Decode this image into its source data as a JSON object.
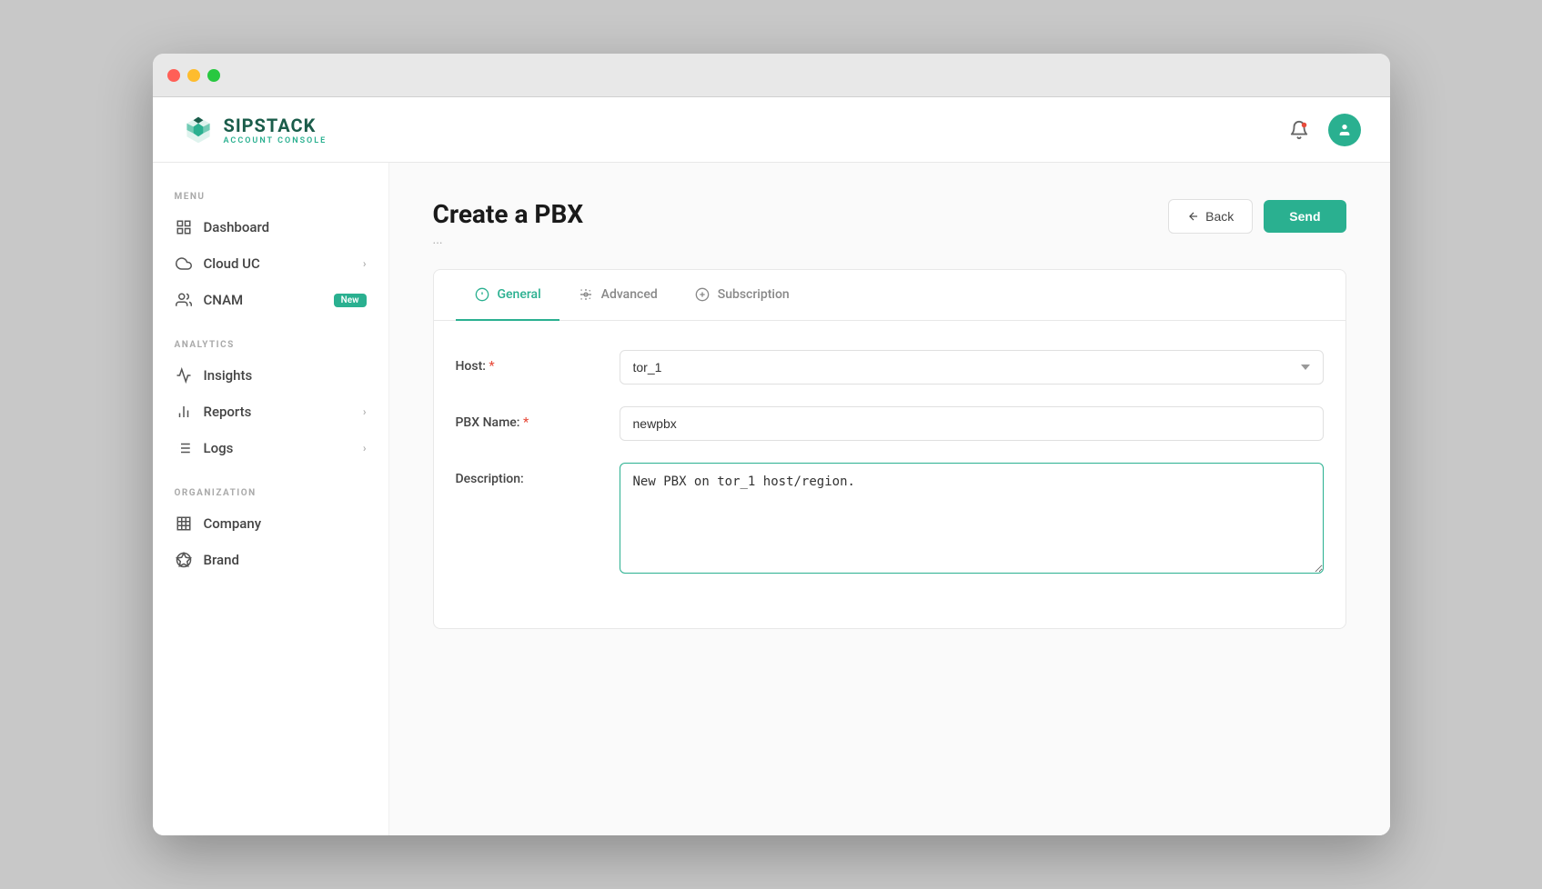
{
  "window": {
    "title": "SIPSTACK Account Console"
  },
  "logo": {
    "main": "SIPSTACK",
    "sub": "ACCOUNT CONSOLE"
  },
  "nav": {
    "bell_icon": "🔔",
    "avatar_icon": "👤"
  },
  "sidebar": {
    "menu_label": "MENU",
    "analytics_label": "ANALYTICS",
    "organization_label": "ORGANIZATION",
    "items_menu": [
      {
        "id": "dashboard",
        "label": "Dashboard",
        "icon": "grid",
        "has_chevron": false,
        "badge": null
      },
      {
        "id": "cloud-uc",
        "label": "Cloud UC",
        "icon": "cloud",
        "has_chevron": true,
        "badge": null
      },
      {
        "id": "cnam",
        "label": "CNAM",
        "icon": "people",
        "has_chevron": false,
        "badge": "New"
      }
    ],
    "items_analytics": [
      {
        "id": "insights",
        "label": "Insights",
        "icon": "chart-line",
        "has_chevron": false,
        "badge": null
      },
      {
        "id": "reports",
        "label": "Reports",
        "icon": "bar-chart",
        "has_chevron": true,
        "badge": null
      },
      {
        "id": "logs",
        "label": "Logs",
        "icon": "list",
        "has_chevron": true,
        "badge": null
      }
    ],
    "items_organization": [
      {
        "id": "company",
        "label": "Company",
        "icon": "building",
        "has_chevron": false,
        "badge": null
      },
      {
        "id": "brand",
        "label": "Brand",
        "icon": "star-circle",
        "has_chevron": false,
        "badge": null
      }
    ]
  },
  "page": {
    "title": "Create a PBX",
    "subtitle": "...",
    "back_label": "Back",
    "send_label": "Send"
  },
  "tabs": [
    {
      "id": "general",
      "label": "General",
      "icon": "info-circle",
      "active": true
    },
    {
      "id": "advanced",
      "label": "Advanced",
      "icon": "gear",
      "active": false
    },
    {
      "id": "subscription",
      "label": "Subscription",
      "icon": "circle-dollar",
      "active": false
    }
  ],
  "form": {
    "host_label": "Host:",
    "host_placeholder": "tor_1",
    "host_value": "tor_1",
    "pbx_name_label": "PBX Name:",
    "pbx_name_value": "newpbx",
    "pbx_name_placeholder": "",
    "description_label": "Description:",
    "description_value": "New PBX on tor_1 host/region.",
    "description_placeholder": ""
  }
}
